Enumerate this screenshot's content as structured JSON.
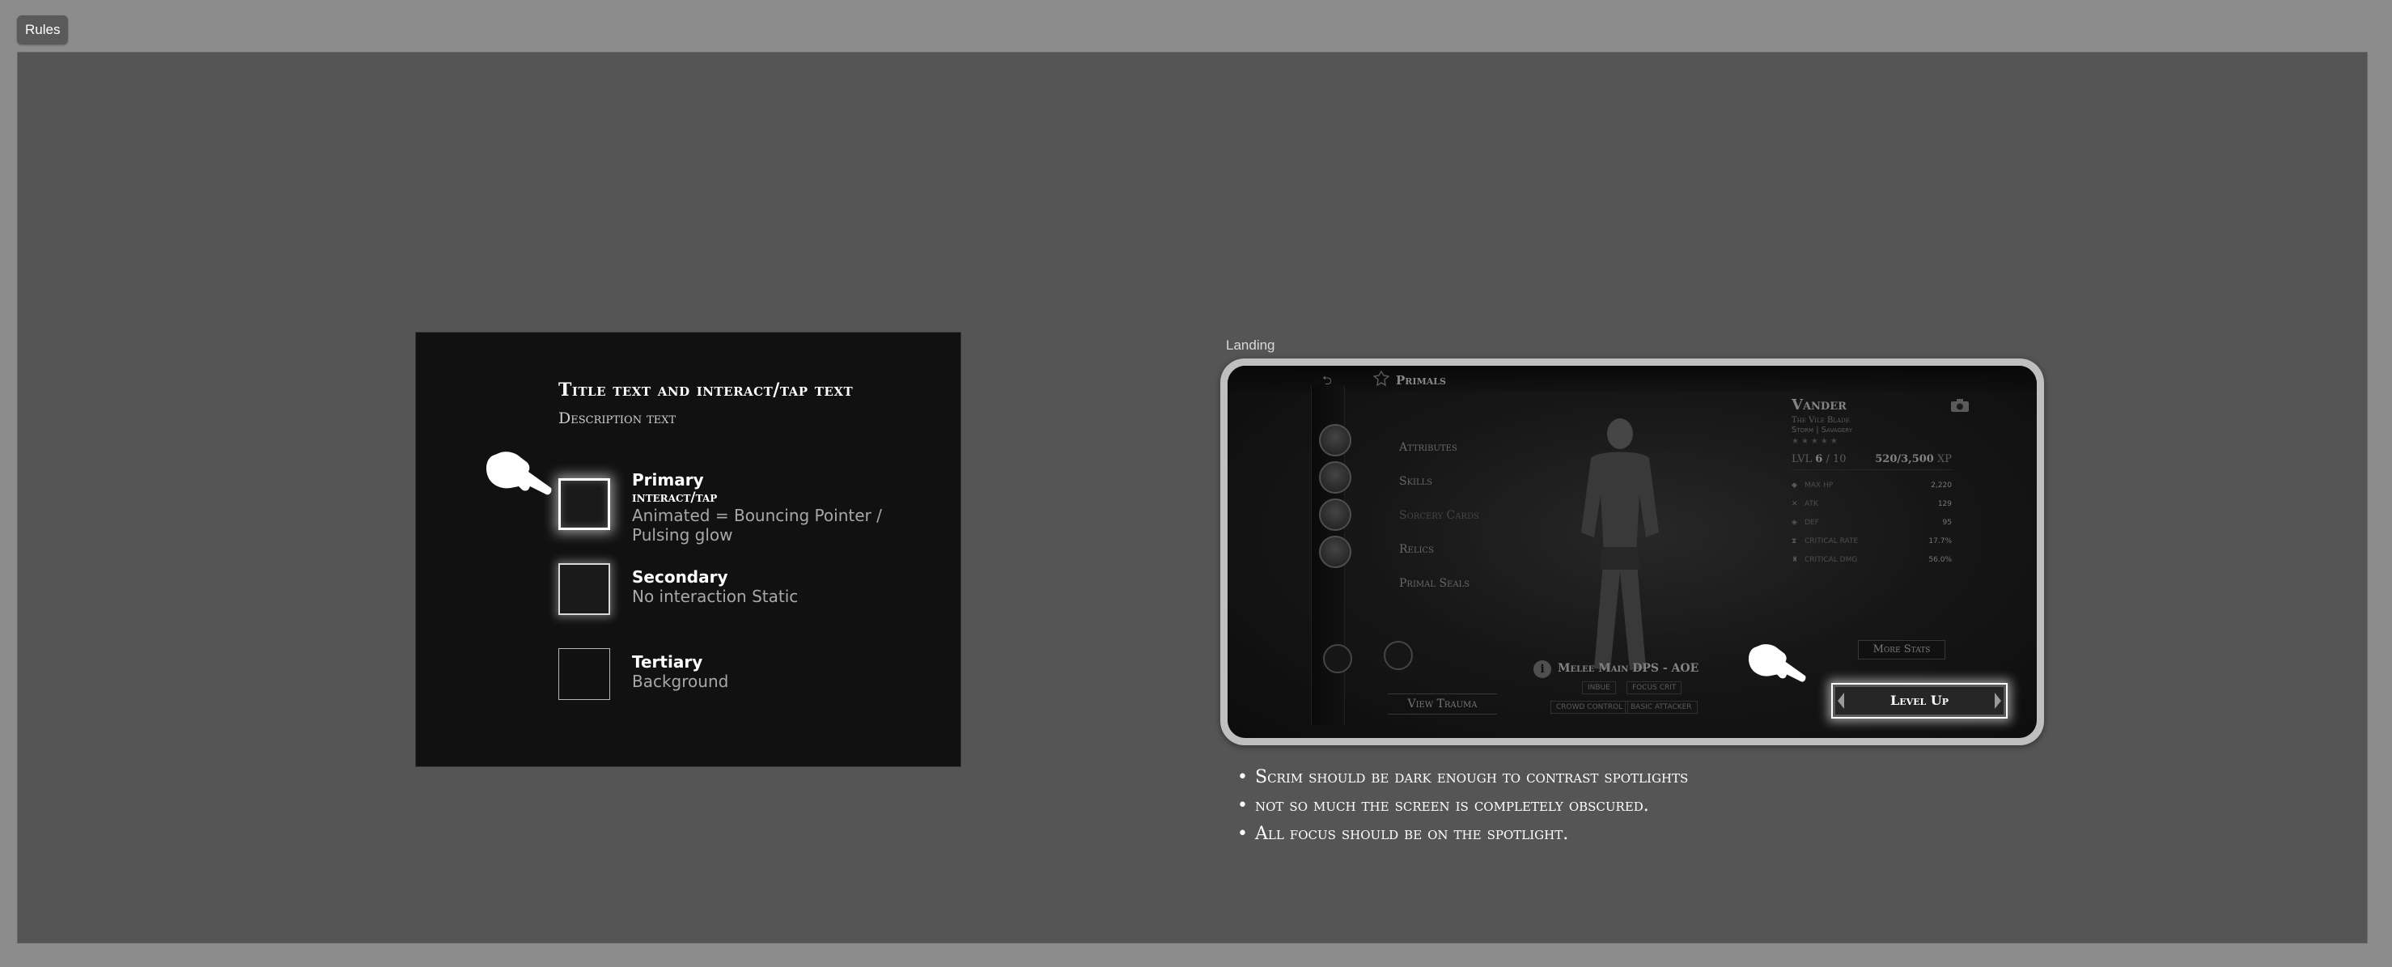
{
  "tab": {
    "label": "Rules"
  },
  "legend": {
    "title": "Title text and interact/tap text",
    "description": "Description text",
    "primary": {
      "head": "Primary",
      "sub": "interact/tap",
      "note": "Animated = Bouncing Pointer / Pulsing glow"
    },
    "secondary": {
      "head": "Secondary",
      "note": "No interaction Static"
    },
    "tertiary": {
      "head": "Tertiary",
      "note": "Background"
    }
  },
  "landing": {
    "label": "Landing",
    "header": {
      "title": "Primals"
    },
    "menu": [
      "Attributes",
      "Skills",
      "Sorcery Cards",
      "Relics",
      "Primal Seals"
    ],
    "view_trauma": "View Trauma",
    "role": {
      "title": "Melee Main DPS - AOE",
      "tags": [
        "Inbue",
        "Focus Crit",
        "Crowd Control",
        "Basic Attacker"
      ]
    },
    "character": {
      "name": "Vander",
      "subtitle": "The Vile Blade",
      "elements": "Storm | Savagery",
      "level_label": "LVL",
      "level_current": "6",
      "level_max": "/ 10",
      "xp": "520/3,500",
      "xp_unit": "XP",
      "stats": [
        {
          "icon": "diamond-icon",
          "label": "Max HP",
          "value": "2,220"
        },
        {
          "icon": "swords-icon",
          "label": "ATK",
          "value": "129"
        },
        {
          "icon": "shield-icon",
          "label": "DEF",
          "value": "95"
        },
        {
          "icon": "hourglass-icon",
          "label": "Critical Rate",
          "value": "17.7%"
        },
        {
          "icon": "crit-dmg-icon",
          "label": "Critical DMG",
          "value": "56.0%"
        }
      ],
      "more_stats": "More Stats"
    },
    "level_up": "Level Up"
  },
  "notes": [
    "Scrim should be dark enough to contrast spotlights",
    "not so much the screen is completely obscured.",
    "All focus should be on the spotlight."
  ]
}
